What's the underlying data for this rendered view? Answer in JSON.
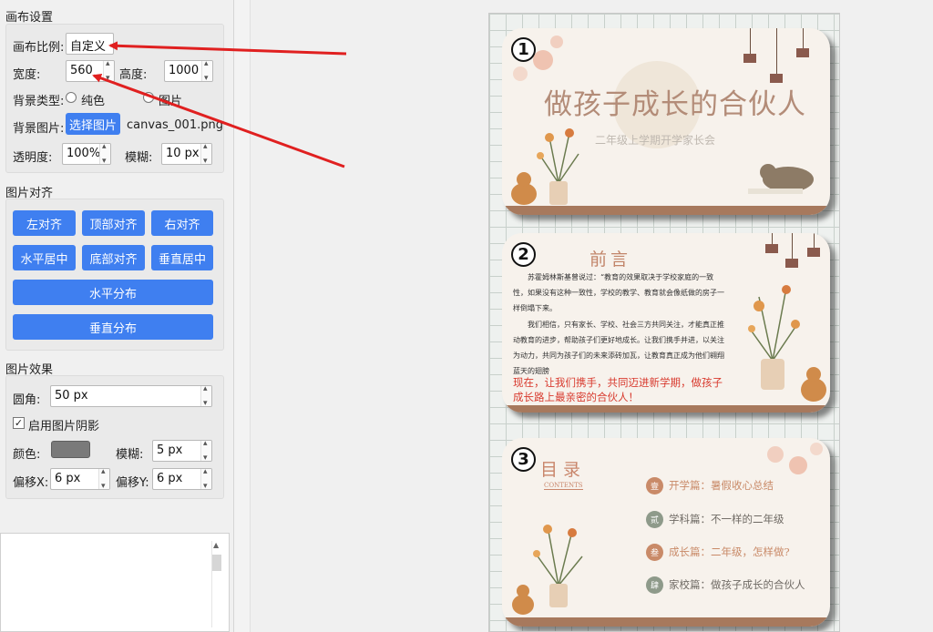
{
  "canvas_settings": {
    "section_title": "画布设置",
    "ratio_label": "画布比例:",
    "ratio_value": "自定义",
    "width_label": "宽度:",
    "width_value": "560",
    "height_label": "高度:",
    "height_value": "1000",
    "bg_type_label": "背景类型:",
    "bg_type_solid": "纯色",
    "bg_type_image": "图片",
    "bg_image_label": "背景图片:",
    "bg_image_button": "选择图片",
    "bg_image_file": "canvas_001.png",
    "opacity_label": "透明度:",
    "opacity_value": "100%",
    "blur_label": "模糊:",
    "blur_value": "10 px"
  },
  "image_align": {
    "section_title": "图片对齐",
    "align_left": "左对齐",
    "align_top": "顶部对齐",
    "align_right": "右对齐",
    "center_h": "水平居中",
    "align_bottom": "底部对齐",
    "center_v": "垂直居中",
    "distribute_h": "水平分布",
    "distribute_v": "垂直分布"
  },
  "image_effects": {
    "section_title": "图片效果",
    "radius_label": "圆角:",
    "radius_value": "50 px",
    "shadow_enable": "启用图片阴影",
    "shadow_checked": "✓",
    "color_label": "颜色:",
    "color_value": "#7a7a7a",
    "blur_label": "模糊:",
    "blur_value": "5 px",
    "offset_x_label": "偏移X:",
    "offset_x_value": "6 px",
    "offset_y_label": "偏移Y:",
    "offset_y_value": "6 px"
  },
  "preview": {
    "card1": {
      "number": "1",
      "title": "做孩子成长的合伙人",
      "subtitle": "二年级上学期开学家长会"
    },
    "card2": {
      "number": "2",
      "title": "前言",
      "para1": "苏霍姆林斯基曾说过：“教育的效果取决于学校家庭的一致性，如果没有这种一致性，学校的教学、教育就会像纸做的房子一样倒塌下来。",
      "para2": "我们相信，只有家长、学校、社会三方共同关注，才能真正推动教育的进步，帮助孩子们更好地成长。让我们携手并进，以关注为动力，共同为孩子们的未来添砖加瓦，让教育真正成为他们翱翔蓝天的翅膀",
      "highlight": "现在，让我们携手，共同迈进新学期，做孩子成长路上最亲密的合伙人！"
    },
    "card3": {
      "number": "3",
      "title": "目录",
      "contents_label": "CONTENTS",
      "items": [
        {
          "num": "壹",
          "text": "开学篇：暑假收心总结",
          "color": "#c98a68"
        },
        {
          "num": "贰",
          "text": "学科篇：不一样的二年级",
          "color": "#8e9a8a"
        },
        {
          "num": "叁",
          "text": "成长篇：二年级，怎样做?",
          "color": "#c98a68"
        },
        {
          "num": "肆",
          "text": "家校篇：做孩子成长的合伙人",
          "color": "#8e9a8a"
        }
      ]
    }
  },
  "colors": {
    "accent": "#3f7ff0",
    "arrow": "#e02020"
  }
}
